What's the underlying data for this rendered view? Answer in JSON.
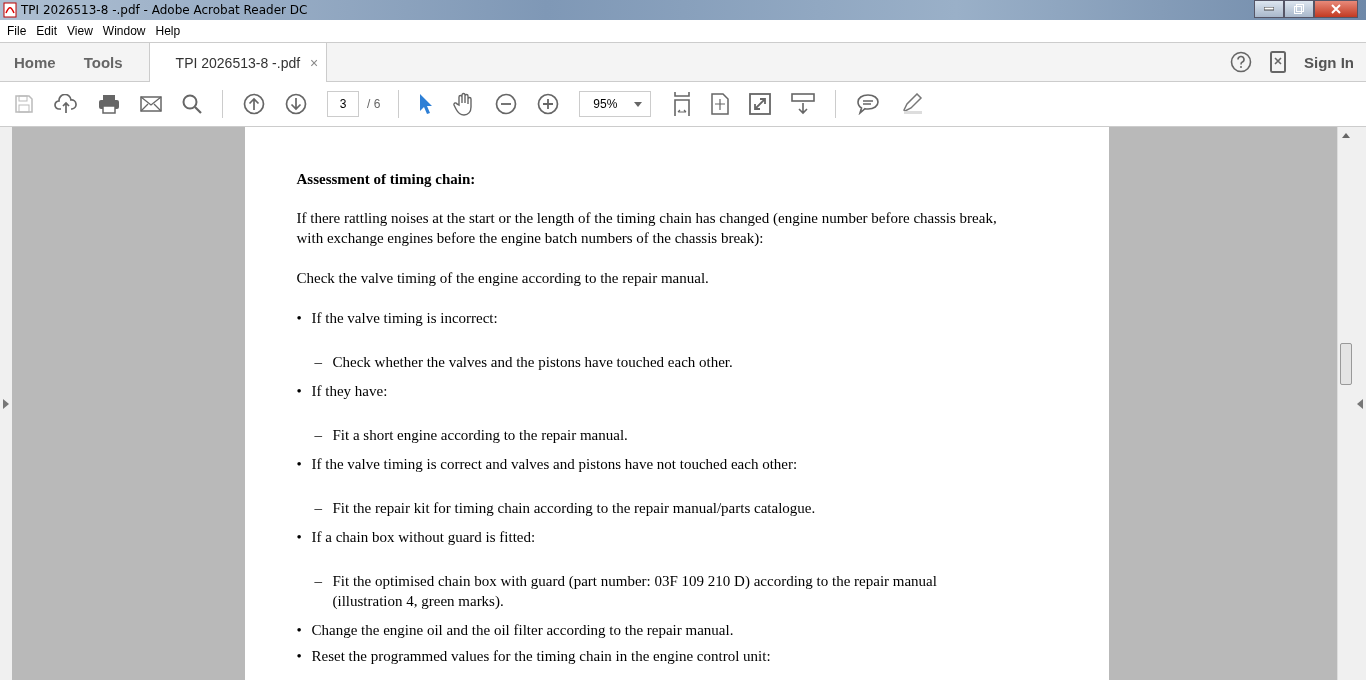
{
  "window": {
    "title": "TPI 2026513-8 -.pdf - Adobe Acrobat Reader DC"
  },
  "menu": [
    "File",
    "Edit",
    "View",
    "Window",
    "Help"
  ],
  "tabs": [
    {
      "label": "Home",
      "selected": false
    },
    {
      "label": "Tools",
      "selected": false
    },
    {
      "label": "TPI 2026513-8 -.pdf",
      "selected": true,
      "close": "×"
    }
  ],
  "sign_in": "Sign In",
  "toolbar": {
    "page": "3",
    "page_total": "/ 6",
    "zoom": "95%"
  },
  "document": [
    {
      "kind": "heading",
      "text": "Assessment of timing chain:"
    },
    {
      "kind": "para",
      "text": "If there rattling noises at the start or the length of the timing chain has changed (engine number before chassis break, with exchange engines before the engine batch numbers of the chassis break):"
    },
    {
      "kind": "para",
      "text": "Check the valve timing of the engine according to the repair manual."
    },
    {
      "kind": "bullet",
      "marker": "•",
      "text": "If the valve timing is incorrect:"
    },
    {
      "kind": "dash",
      "marker": "–",
      "text": "Check whether the valves and the pistons have touched each other."
    },
    {
      "kind": "bullet",
      "marker": "•",
      "text": "If they have:"
    },
    {
      "kind": "dash",
      "marker": "–",
      "text": "Fit a short engine according to the repair manual."
    },
    {
      "kind": "bullet",
      "marker": "•",
      "text": "If the valve timing is correct and valves and pistons have not touched each other:"
    },
    {
      "kind": "dash",
      "marker": "–",
      "text": "Fit the repair kit for timing chain according to the repair manual/parts catalogue."
    },
    {
      "kind": "bullet",
      "marker": "•",
      "text": "If a chain box without guard is fitted:"
    },
    {
      "kind": "dash",
      "marker": "–",
      "text": "Fit the optimised chain box with guard (part number: 03F 109 210 D) according to the repair manual (illustration 4, green marks)."
    },
    {
      "kind": "bullet",
      "marker": "•",
      "text": "Change the engine oil and the oil filter according to the repair manual."
    },
    {
      "kind": "bullet",
      "marker": "•",
      "text": "Reset the programmed values for the timing chain in the engine control unit:"
    }
  ]
}
